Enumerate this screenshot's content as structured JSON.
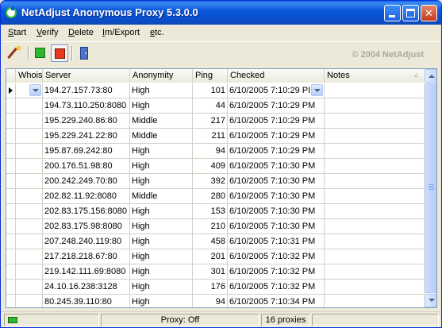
{
  "window": {
    "title": "NetAdjust Anonymous Proxy 5.3.0.0",
    "title_bar_color": "#0B58DA"
  },
  "menu": {
    "items": [
      "Start",
      "Verify",
      "Delete",
      "Im/Export",
      "etc."
    ]
  },
  "toolbar": {
    "buttons": [
      {
        "icon": "magic-wand-icon"
      },
      {
        "icon": "green-start-icon"
      },
      {
        "icon": "red-stop-icon",
        "pressed": true
      },
      {
        "icon": "exit-door-icon"
      }
    ],
    "copyright": "© 2004 NetAdjust"
  },
  "grid": {
    "columns": [
      "Whois",
      "Server",
      "Anonymity",
      "Ping",
      "Checked",
      "Notes"
    ],
    "sort_indicator": "▵",
    "rows": [
      {
        "whois": "",
        "server": "194.27.157.73:80",
        "anonymity": "High",
        "ping": "101",
        "checked": "6/10/2005 7:10:29 PI",
        "notes": "",
        "current": true
      },
      {
        "whois": "",
        "server": "194.73.110.250:8080",
        "anonymity": "High",
        "ping": "44",
        "checked": "6/10/2005 7:10:29 PM",
        "notes": ""
      },
      {
        "whois": "",
        "server": "195.229.240.86:80",
        "anonymity": "Middle",
        "ping": "217",
        "checked": "6/10/2005 7:10:29 PM",
        "notes": ""
      },
      {
        "whois": "",
        "server": "195.229.241.22:80",
        "anonymity": "Middle",
        "ping": "211",
        "checked": "6/10/2005 7:10:29 PM",
        "notes": ""
      },
      {
        "whois": "",
        "server": "195.87.69.242:80",
        "anonymity": "High",
        "ping": "94",
        "checked": "6/10/2005 7:10:29 PM",
        "notes": ""
      },
      {
        "whois": "",
        "server": "200.176.51.98:80",
        "anonymity": "High",
        "ping": "409",
        "checked": "6/10/2005 7:10:30 PM",
        "notes": ""
      },
      {
        "whois": "",
        "server": "200.242.249.70:80",
        "anonymity": "High",
        "ping": "392",
        "checked": "6/10/2005 7:10:30 PM",
        "notes": ""
      },
      {
        "whois": "",
        "server": "202.82.11.92:8080",
        "anonymity": "Middle",
        "ping": "280",
        "checked": "6/10/2005 7:10:30 PM",
        "notes": ""
      },
      {
        "whois": "",
        "server": "202.83.175.156:8080",
        "anonymity": "High",
        "ping": "153",
        "checked": "6/10/2005 7:10:30 PM",
        "notes": ""
      },
      {
        "whois": "",
        "server": "202.83.175.98:8080",
        "anonymity": "High",
        "ping": "210",
        "checked": "6/10/2005 7:10:30 PM",
        "notes": ""
      },
      {
        "whois": "",
        "server": "207.248.240.119:80",
        "anonymity": "High",
        "ping": "458",
        "checked": "6/10/2005 7:10:31 PM",
        "notes": ""
      },
      {
        "whois": "",
        "server": "217.218.218.67:80",
        "anonymity": "High",
        "ping": "201",
        "checked": "6/10/2005 7:10:32 PM",
        "notes": ""
      },
      {
        "whois": "",
        "server": "219.142.111.69:8080",
        "anonymity": "High",
        "ping": "301",
        "checked": "6/10/2005 7:10:32 PM",
        "notes": ""
      },
      {
        "whois": "",
        "server": "24.10.16.238:3128",
        "anonymity": "High",
        "ping": "176",
        "checked": "6/10/2005 7:10:32 PM",
        "notes": ""
      },
      {
        "whois": "",
        "server": "80.245.39.110:80",
        "anonymity": "High",
        "ping": "94",
        "checked": "6/10/2005 7:10:34 PM",
        "notes": ""
      }
    ]
  },
  "status": {
    "indicator_color": "#2FB52F",
    "proxy": "Proxy: Off",
    "count": "16 proxies",
    "extra": ""
  }
}
